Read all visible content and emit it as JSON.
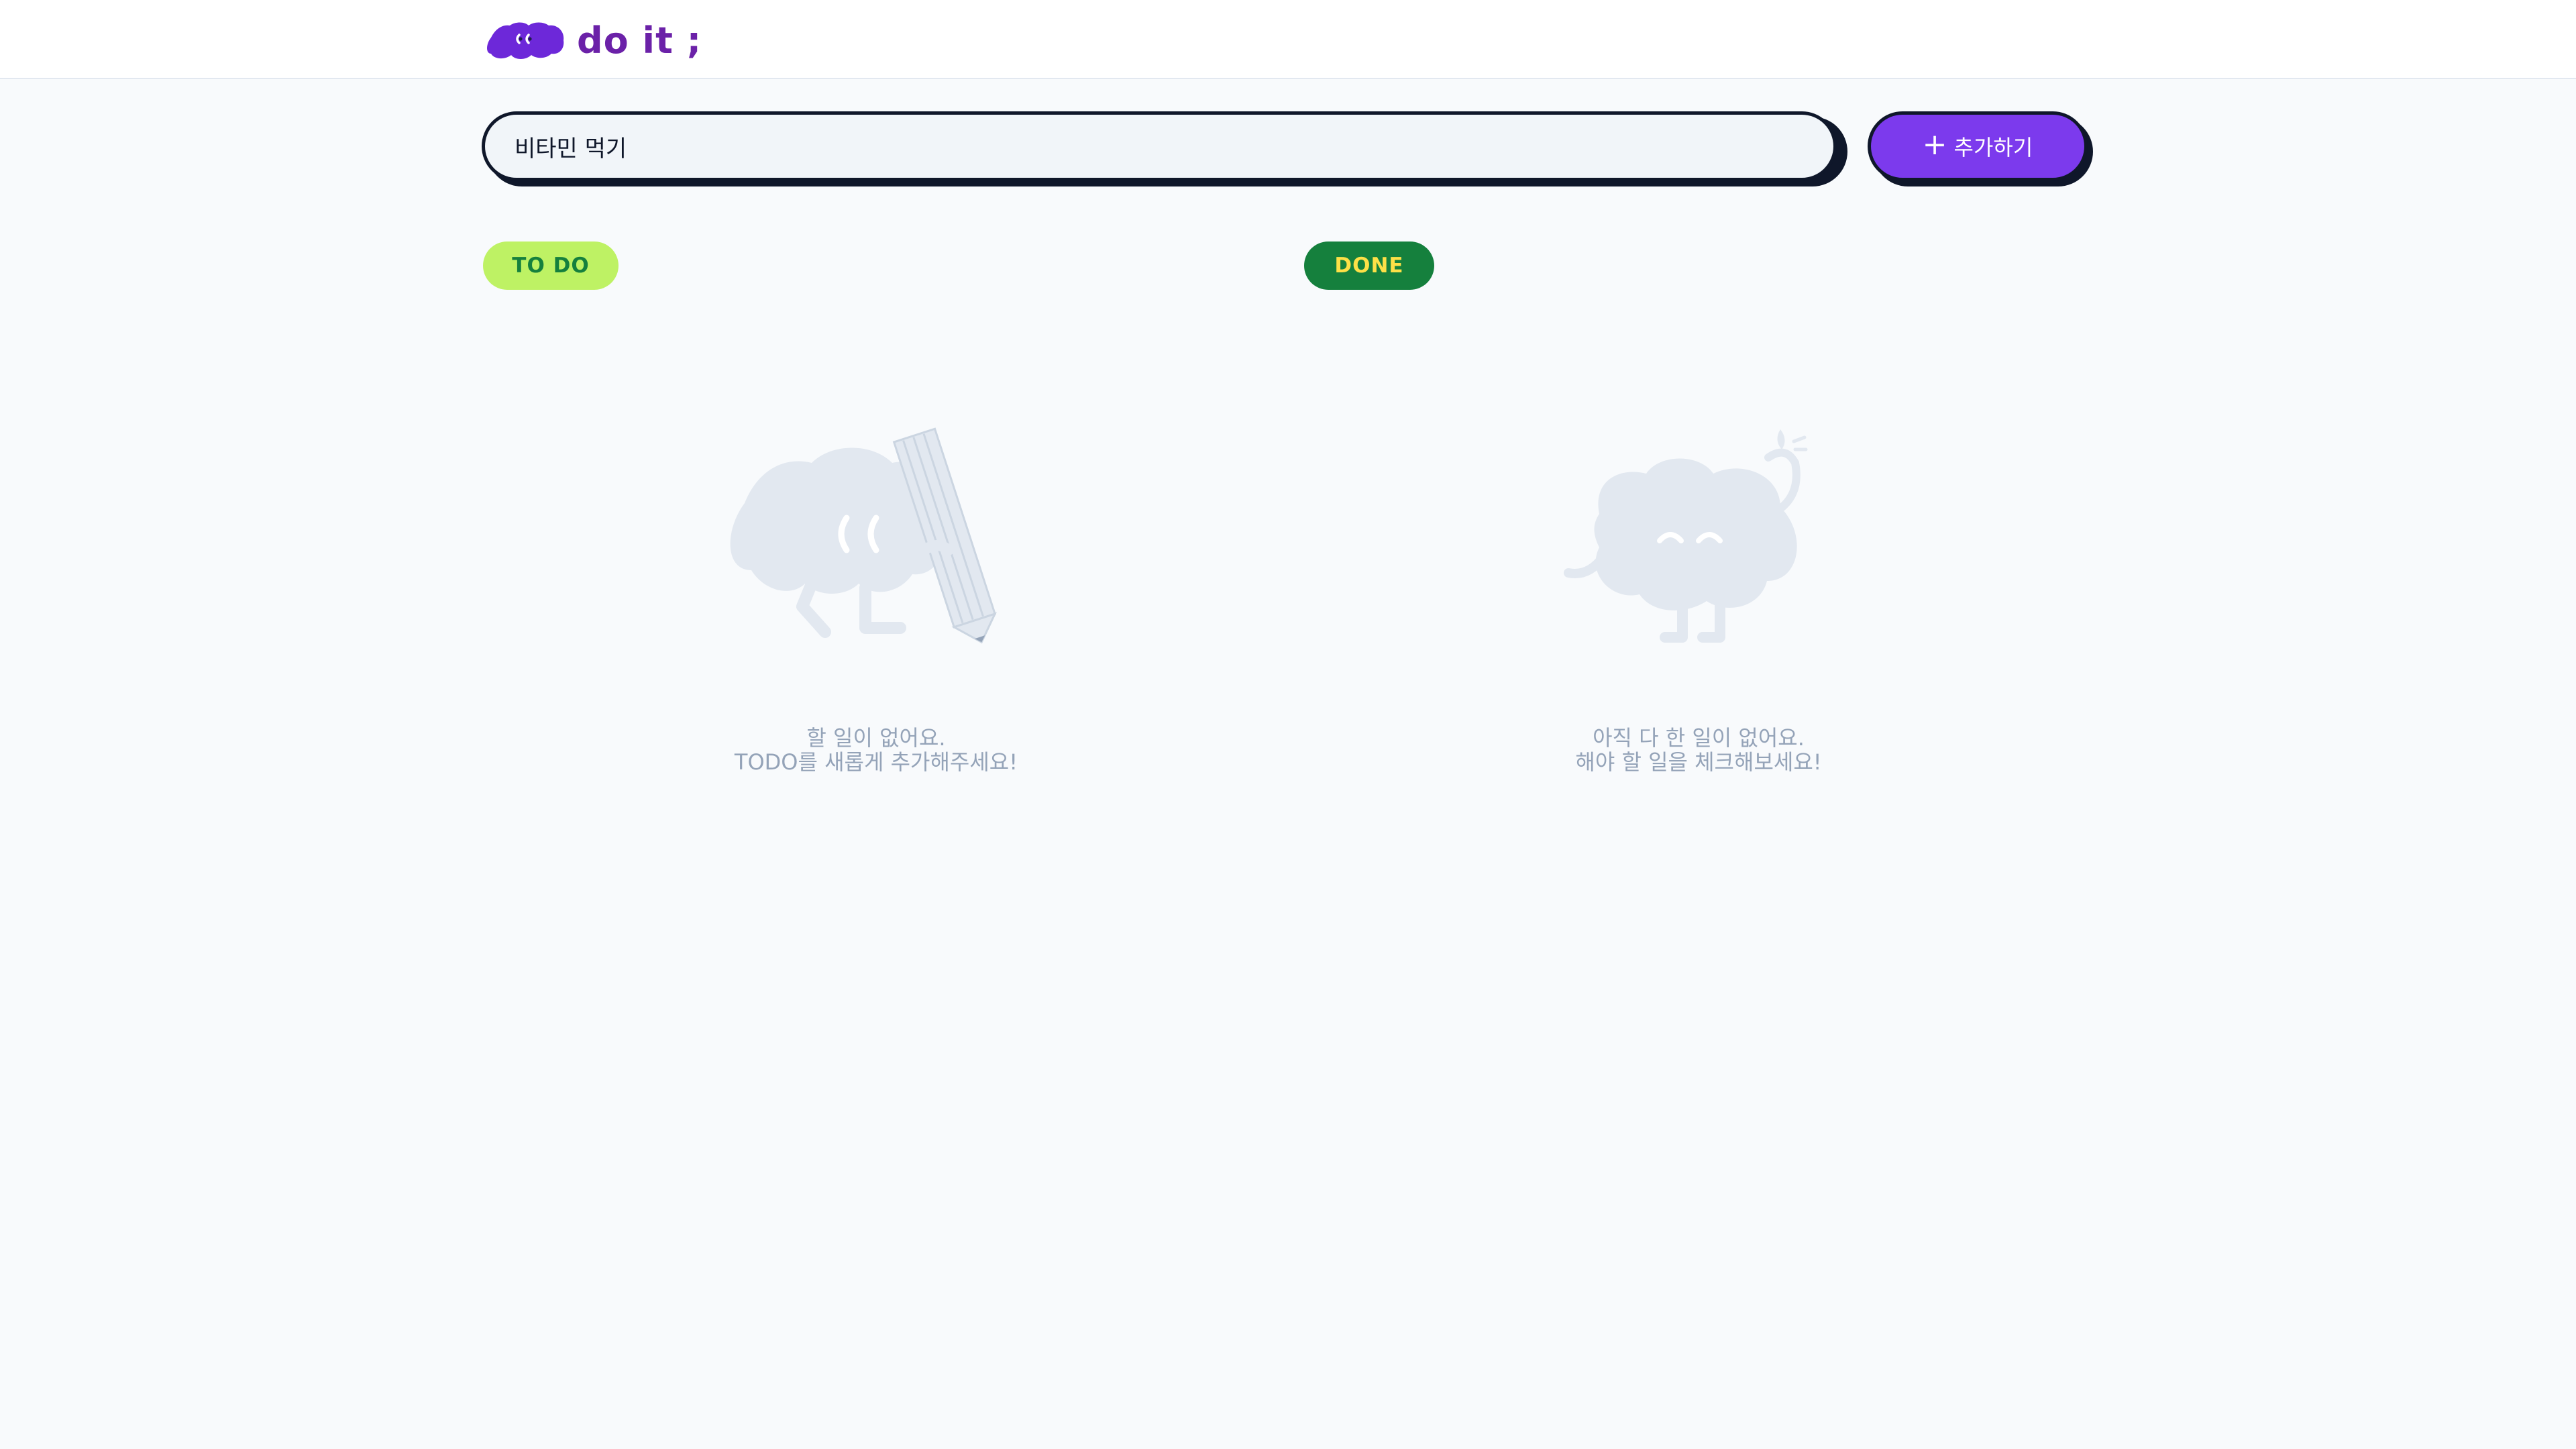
{
  "header": {
    "logo_text": "do it ;",
    "brand_color": "#6b21a8"
  },
  "add_form": {
    "input_value": "비타민 먹기",
    "add_button_label": "추가하기",
    "plus_icon": "+",
    "button_color": "#7c3aed"
  },
  "todo": {
    "badge_label": "TO DO",
    "badge_color": "#bef264",
    "empty_line1": "할 일이 없어요.",
    "empty_line2": "TODO를 새롭게 추가해주세요!",
    "illustration": "cloud-mascot-with-pencil"
  },
  "done": {
    "badge_label": "DONE",
    "badge_color": "#15803d",
    "empty_line1": "아직 다 한 일이 없어요.",
    "empty_line2": "해야 할 일을 체크해보세요!",
    "illustration": "cloud-mascot-waving"
  }
}
